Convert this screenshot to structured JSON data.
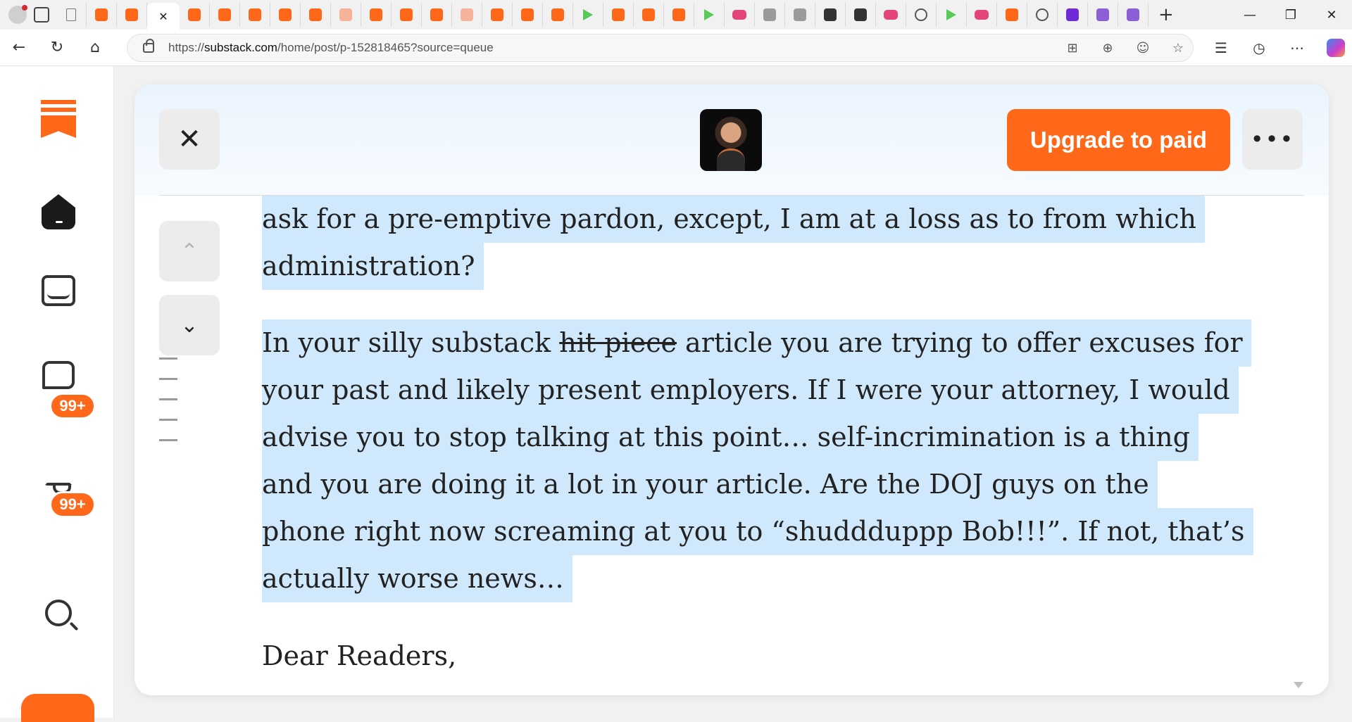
{
  "browser": {
    "url_prefix": "https://",
    "url_domain": "substack.com",
    "url_path": "/home/post/p-152818465?source=queue",
    "tabs": [
      {
        "icon": "document-icon"
      },
      {
        "icon": "substack-icon"
      },
      {
        "icon": "substack-icon"
      },
      {
        "icon": "close-icon",
        "active": true
      },
      {
        "icon": "substack-icon"
      },
      {
        "icon": "substack-icon"
      },
      {
        "icon": "substack-icon"
      },
      {
        "icon": "substack-icon"
      },
      {
        "icon": "substack-icon"
      },
      {
        "icon": "log-icon"
      },
      {
        "icon": "substack-icon"
      },
      {
        "icon": "substack-icon"
      },
      {
        "icon": "substack-icon"
      },
      {
        "icon": "person-icon"
      },
      {
        "icon": "substack-icon"
      },
      {
        "icon": "substack-icon"
      },
      {
        "icon": "substack-icon"
      },
      {
        "icon": "play-icon"
      },
      {
        "icon": "substack-icon"
      },
      {
        "icon": "substack-icon"
      },
      {
        "icon": "substack-icon"
      },
      {
        "icon": "play-icon"
      },
      {
        "icon": "youtube-icon"
      },
      {
        "icon": "gray-icon"
      },
      {
        "icon": "search-icon"
      },
      {
        "icon": "b-icon"
      },
      {
        "icon": "dark-icon"
      },
      {
        "icon": "youtube-icon"
      },
      {
        "icon": "grid-icon"
      },
      {
        "icon": "play-icon"
      },
      {
        "icon": "youtube-icon"
      },
      {
        "icon": "substack-icon"
      },
      {
        "icon": "grid-icon"
      },
      {
        "icon": "yahoo-mail-icon"
      },
      {
        "icon": "yahoo-icon"
      },
      {
        "icon": "yahoo-icon"
      }
    ],
    "new_tab_label": "+"
  },
  "sidebar": {
    "inbox_badge": "99+",
    "activity_badge": "99+"
  },
  "reader": {
    "upgrade_label": "Upgrade to paid",
    "more_label": "•••",
    "close_label": "✕",
    "nav_up_label": "⌃",
    "nav_down_label": "⌄"
  },
  "article": {
    "p1_line1": "ask for a pre-emptive pardon, except, I am at a loss as to from which",
    "p1_line2": "administration?",
    "p2_line1_a": "In your silly substack ",
    "p2_line1_strike": "hit piece",
    "p2_line1_b": " article you are trying to offer excuses for",
    "p2_line2": "your past and likely present employers. If I were your attorney, I would",
    "p2_line3": "advise you to stop talking at this point… self-incrimination is a thing",
    "p2_line4": "and you are doing it a lot in your article. Are the DOJ guys on the",
    "p2_line5": "phone right now screaming at you to “shuddduppp Bob!!!”. If not, that’s",
    "p2_line6": "actually worse news…",
    "p3_line1": "Dear Readers,"
  },
  "colors": {
    "accent": "#ff6719",
    "highlight": "#cfe8fc"
  }
}
